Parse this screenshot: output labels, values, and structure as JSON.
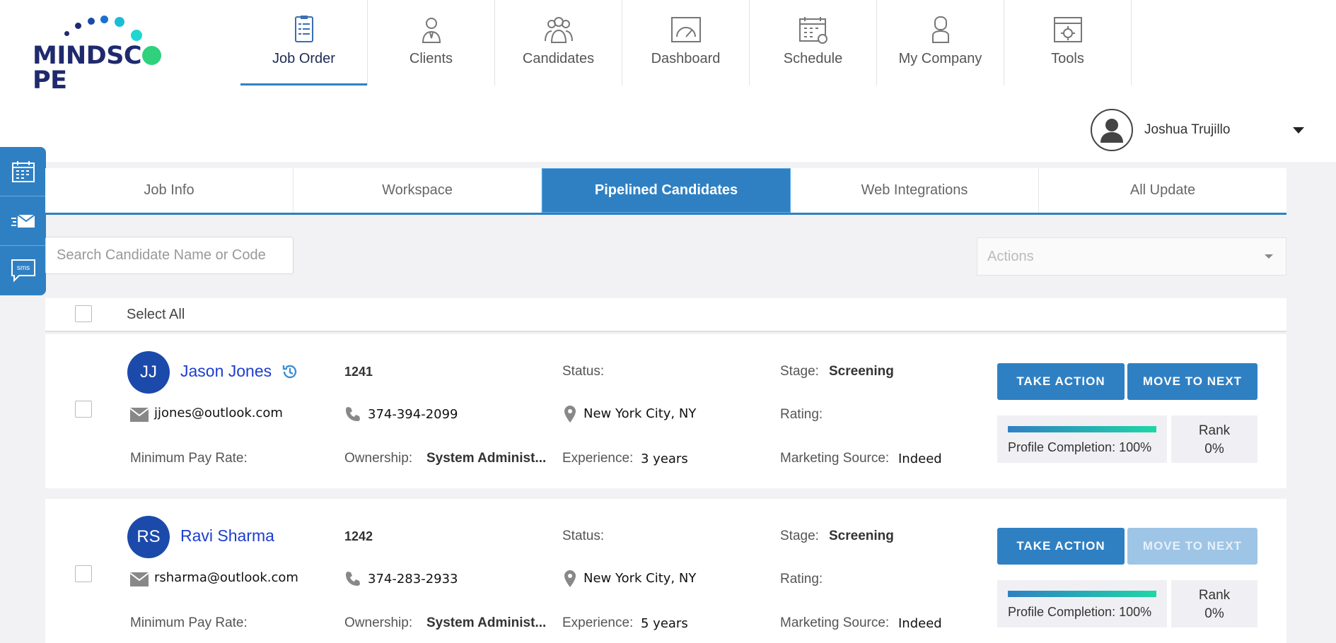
{
  "brand": {
    "name": "MINDSCOPE",
    "color": "#1f2a6e",
    "accent": "#2fd17d"
  },
  "nav": [
    {
      "label": "Job Order",
      "icon": "job-order-icon",
      "active": true
    },
    {
      "label": "Clients",
      "icon": "client-person-icon"
    },
    {
      "label": "Candidates",
      "icon": "candidates-group-icon"
    },
    {
      "label": "Dashboard",
      "icon": "dashboard-gauge-icon"
    },
    {
      "label": "Schedule",
      "icon": "calendar-icon"
    },
    {
      "label": "My Company",
      "icon": "company-person-icon"
    },
    {
      "label": "Tools",
      "icon": "tools-icon"
    }
  ],
  "user": {
    "name": "Joshua Trujillo"
  },
  "side_widgets": [
    {
      "icon": "calendar-icon"
    },
    {
      "icon": "email-icon"
    },
    {
      "icon": "sms-icon",
      "text": "sms"
    }
  ],
  "tabs": [
    {
      "label": "Job Info"
    },
    {
      "label": "Workspace"
    },
    {
      "label": "Pipelined Candidates",
      "active": true
    },
    {
      "label": "Web Integrations"
    },
    {
      "label": "All Update"
    }
  ],
  "search": {
    "placeholder": "Search Candidate Name or Code",
    "value": ""
  },
  "actions": {
    "placeholder": "Actions"
  },
  "select_all": {
    "label": "Select All"
  },
  "labels": {
    "status": "Status:",
    "stage": "Stage:",
    "rating": "Rating:",
    "min_pay": "Minimum Pay Rate:",
    "ownership": "Ownership:",
    "experience": "Experience:",
    "marketing": "Marketing Source:",
    "take_action": "TAKE ACTION",
    "move_next": "MOVE TO NEXT",
    "profile": "Profile Completion:",
    "rank": "Rank"
  },
  "candidates": [
    {
      "initials": "JJ",
      "name": "Jason Jones",
      "has_history": true,
      "code": "1241",
      "email": "jjones@outlook.com",
      "phone": "374-394-2099",
      "location": "New York City, NY",
      "stage": "Screening",
      "ownership": "System Administ...",
      "experience": "3 years",
      "marketing_source": "Indeed",
      "profile_completion": "100%",
      "profile_fraction": 1.0,
      "rank": "0%",
      "move_next_enabled": true
    },
    {
      "initials": "RS",
      "name": "Ravi Sharma",
      "has_history": false,
      "code": "1242",
      "email": "rsharma@outlook.com",
      "phone": "374-283-2933",
      "location": "New York City, NY",
      "stage": "Screening",
      "ownership": "System Administ...",
      "experience": "5 years",
      "marketing_source": "Indeed",
      "profile_completion": "100%",
      "profile_fraction": 1.0,
      "rank": "0%",
      "move_next_enabled": false
    }
  ]
}
